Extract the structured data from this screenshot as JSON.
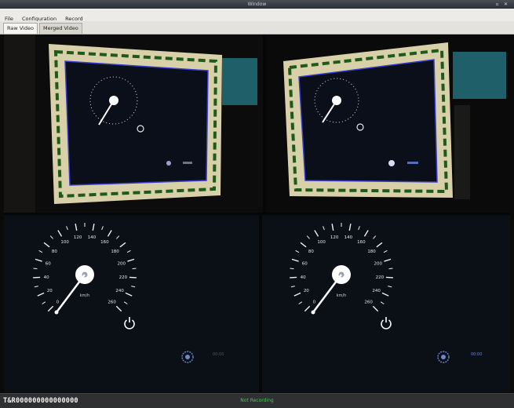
{
  "window": {
    "title": "Window",
    "close_icon": "close-icon",
    "restore_icon": "restore-icon"
  },
  "menu": {
    "items": [
      "File",
      "Configuration",
      "Record"
    ]
  },
  "tabs": [
    {
      "label": "Raw Video",
      "active": true
    },
    {
      "label": "Merged Video",
      "active": false
    }
  ],
  "gauge": {
    "scale_labels": [
      "0",
      "20",
      "40",
      "60",
      "80",
      "100",
      "120",
      "140",
      "160",
      "180",
      "200",
      "220",
      "240",
      "260"
    ],
    "unit": "km/h",
    "power_icon": "power-icon",
    "settings_icon": "gear-icon",
    "left_readout": "00:00",
    "right_readout": "00:00"
  },
  "status": {
    "counter": "T&R000000000000000",
    "recording": "Not Recording",
    "recording_color": "#39d04a"
  }
}
